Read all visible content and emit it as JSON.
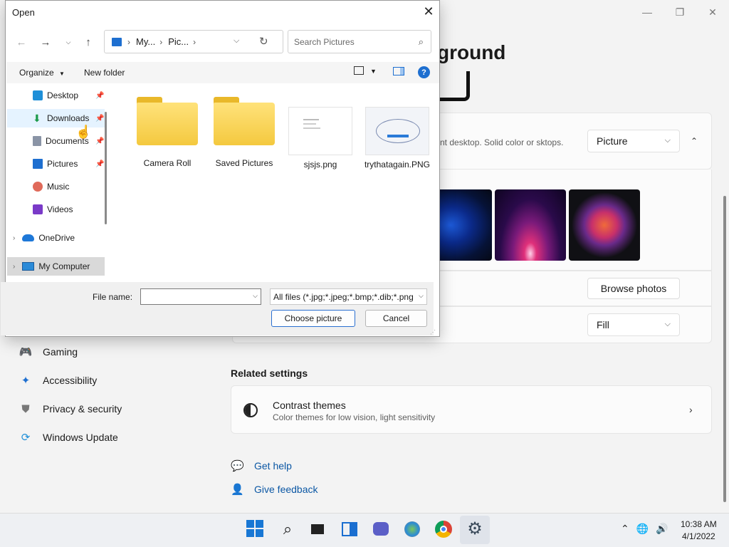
{
  "settings": {
    "heading": "ground",
    "bg_desc": "nt desktop. Solid color or sktops.",
    "bg_type_value": "Picture",
    "browse_label": "Browse photos",
    "fit_value": "Fill",
    "nav": [
      {
        "label": "Gaming"
      },
      {
        "label": "Accessibility"
      },
      {
        "label": "Privacy & security"
      },
      {
        "label": "Windows Update"
      }
    ],
    "related_title": "Related settings",
    "contrast_title": "Contrast themes",
    "contrast_sub": "Color themes for low vision, light sensitivity",
    "help_label": "Get help",
    "feedback_label": "Give feedback"
  },
  "dialog": {
    "title": "Open",
    "breadcrumb": [
      "My...",
      "Pic..."
    ],
    "search_placeholder": "Search Pictures",
    "organize_label": "Organize",
    "new_folder_label": "New folder",
    "nav_items": [
      {
        "label": "Desktop"
      },
      {
        "label": "Downloads"
      },
      {
        "label": "Documents"
      },
      {
        "label": "Pictures"
      },
      {
        "label": "Music"
      },
      {
        "label": "Videos"
      },
      {
        "label": "OneDrive"
      },
      {
        "label": "My Computer"
      }
    ],
    "files": [
      {
        "name": "Camera Roll"
      },
      {
        "name": "Saved Pictures"
      },
      {
        "name": "sjsjs.png"
      },
      {
        "name": "trythatagain.PNG"
      }
    ],
    "filename_label": "File name:",
    "filename_value": "",
    "filetype_value": "All files (*.jpg;*.jpeg;*.bmp;*.dib;*.png",
    "choose_label": "Choose picture",
    "cancel_label": "Cancel"
  },
  "taskbar": {
    "time": "10:38 AM",
    "date": "4/1/2022"
  },
  "colors": {
    "accent": "#1877d4",
    "link": "#0b57a4",
    "folder": "#f4c93f"
  }
}
